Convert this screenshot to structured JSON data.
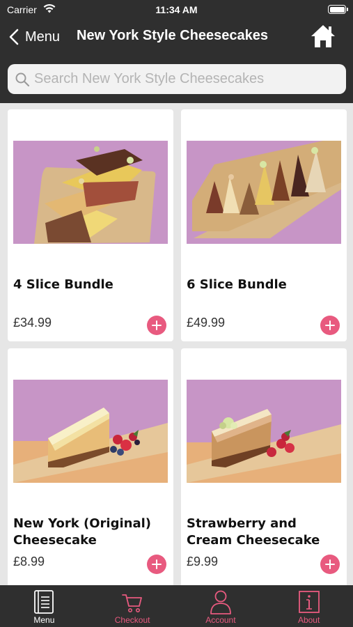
{
  "status_bar": {
    "carrier": "Carrier",
    "time": "11:34 AM"
  },
  "nav": {
    "back_label": "Menu",
    "title": "New York Style Cheesecakes"
  },
  "search": {
    "placeholder": "Search New York Style Cheesecakes"
  },
  "products": [
    {
      "name": "4 Slice Bundle",
      "price": "£34.99"
    },
    {
      "name": "6 Slice Bundle",
      "price": "£49.99"
    },
    {
      "name": "New York (Original) Cheesecake",
      "price": "£8.99"
    },
    {
      "name": "Strawberry and Cream Cheesecake",
      "price": "£9.99"
    }
  ],
  "tabs": [
    {
      "label": "Menu",
      "icon": "menu-book-icon",
      "active": true
    },
    {
      "label": "Checkout",
      "icon": "cart-icon",
      "active": false
    },
    {
      "label": "Account",
      "icon": "person-icon",
      "active": false
    },
    {
      "label": "About",
      "icon": "info-icon",
      "active": false
    }
  ],
  "colors": {
    "bar": "#2f2f2f",
    "accent": "#e85a7f",
    "background": "#e6e6e6",
    "active_tab": "#ffffff"
  }
}
